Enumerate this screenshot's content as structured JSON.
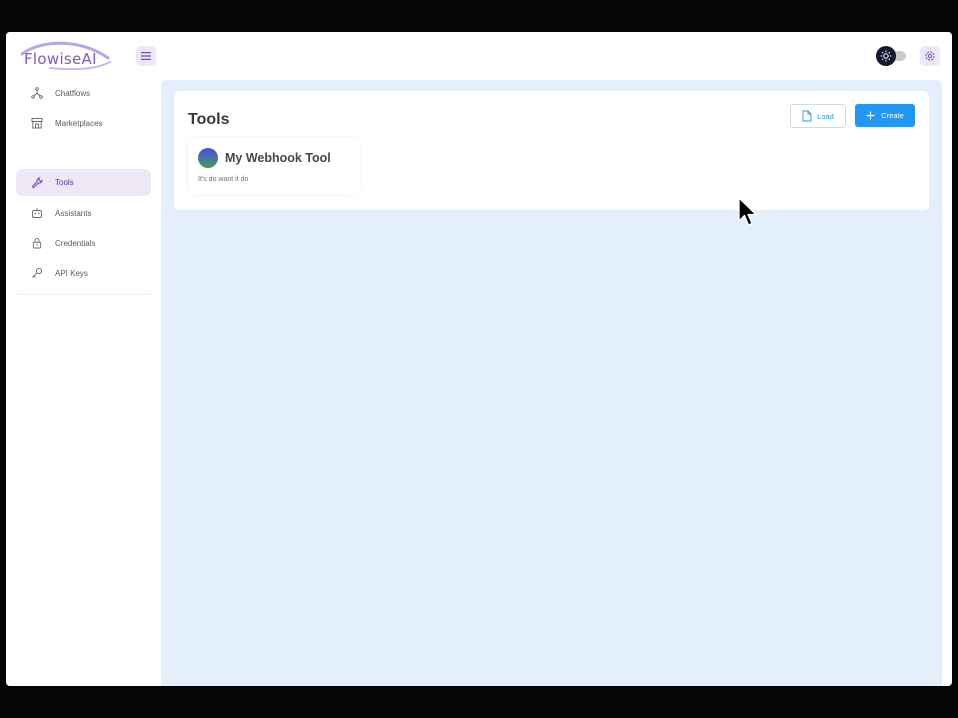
{
  "app": {
    "logo_text": "FlowiseAI"
  },
  "sidebar": {
    "items": [
      {
        "label": "Chatflows",
        "icon": "hierarchy-icon",
        "active": false
      },
      {
        "label": "Marketplaces",
        "icon": "store-icon",
        "active": false
      },
      {
        "label": "Tools",
        "icon": "tool-icon",
        "active": true
      },
      {
        "label": "Assistants",
        "icon": "robot-icon",
        "active": false
      },
      {
        "label": "Credentials",
        "icon": "lock-icon",
        "active": false
      },
      {
        "label": "API Keys",
        "icon": "key-icon",
        "active": false
      }
    ]
  },
  "page": {
    "title": "Tools",
    "load_label": "Load",
    "create_label": "Create"
  },
  "tools": [
    {
      "name": "My Webhook Tool",
      "description": "It's do want it do"
    }
  ],
  "colors": {
    "accent": "#2196f3",
    "brand": "#7c5cc4",
    "active_nav_bg": "#ede7f6",
    "main_bg": "#e3f0fb"
  }
}
